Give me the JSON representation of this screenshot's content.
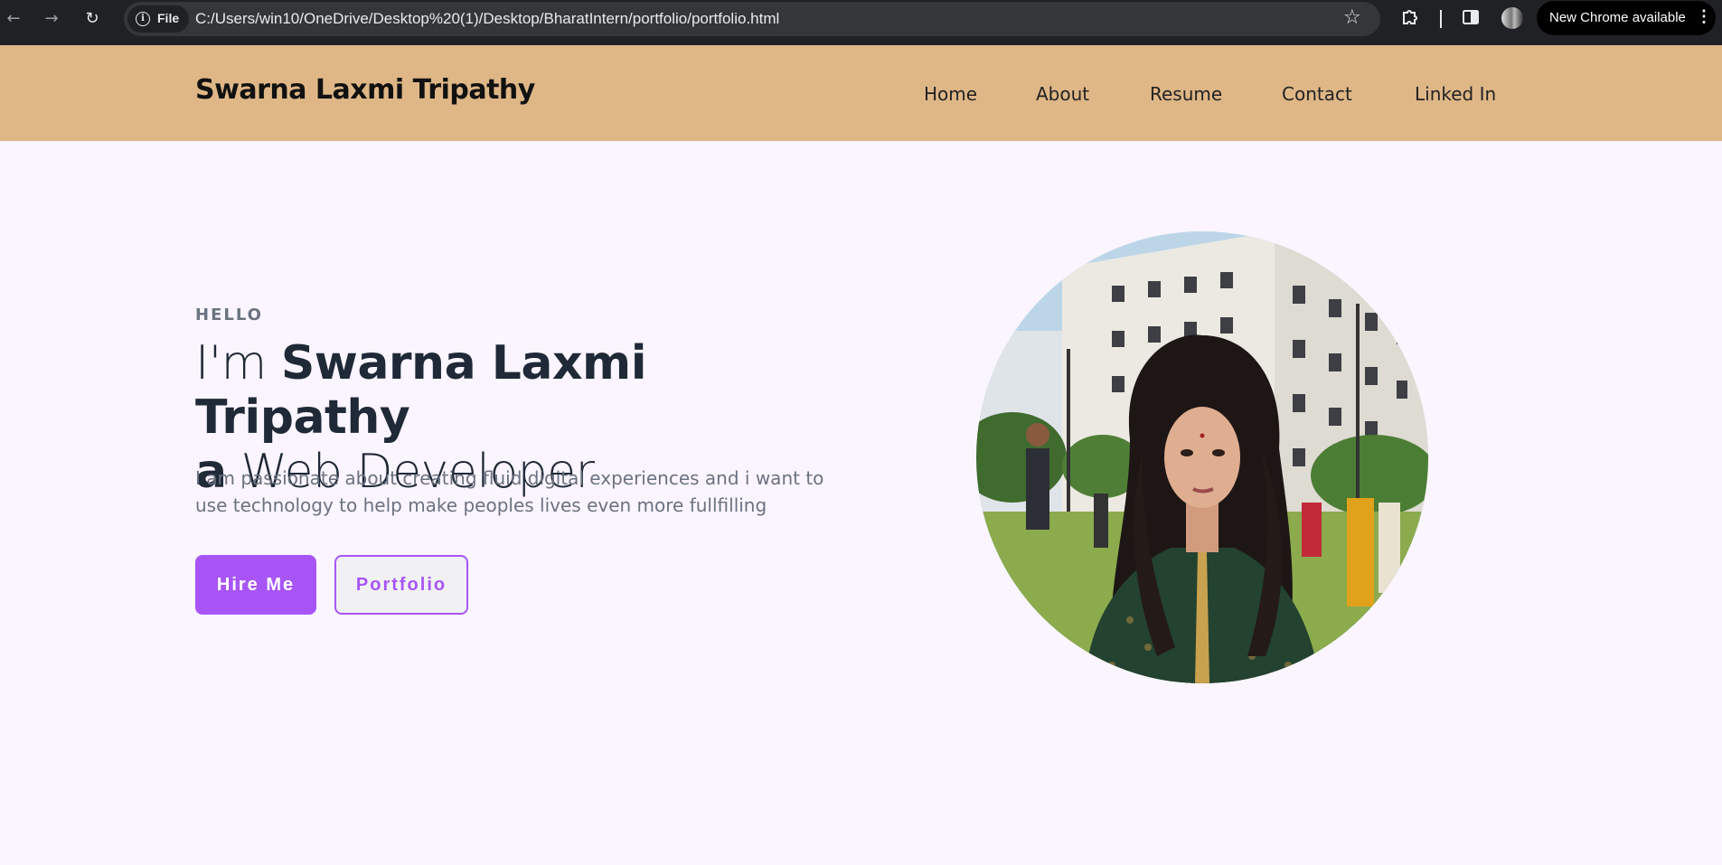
{
  "browser": {
    "back_icon": "←",
    "forward_icon": "→",
    "reload_icon": "↻",
    "site_chip_label": "File",
    "info_icon": "i",
    "url": "C:/Users/win10/OneDrive/Desktop%20(1)/Desktop/BharatIntern/portfolio/portfolio.html",
    "star_icon": "☆",
    "update_label": "New Chrome available",
    "kebab_icon": "⋮"
  },
  "header": {
    "logo": "Swarna Laxmi Tripathy",
    "nav": [
      "Home",
      "About",
      "Resume",
      "Contact",
      "Linked In"
    ]
  },
  "hero": {
    "eyebrow": "HELLO",
    "headline_prefix": "I'm ",
    "headline_name": "Swarna Laxmi Tripathy",
    "headline_article": "a",
    "headline_role": " Web Developer",
    "description": "I am passionate about creating fluid digital experiences and i want to use technology to help make peoples lives even more fullfilling",
    "primary_button": "Hire Me",
    "secondary_button": "Portfolio"
  },
  "colors": {
    "header_bg": "#dfb787",
    "page_bg": "#faf5ff",
    "accent": "#a855f7"
  }
}
